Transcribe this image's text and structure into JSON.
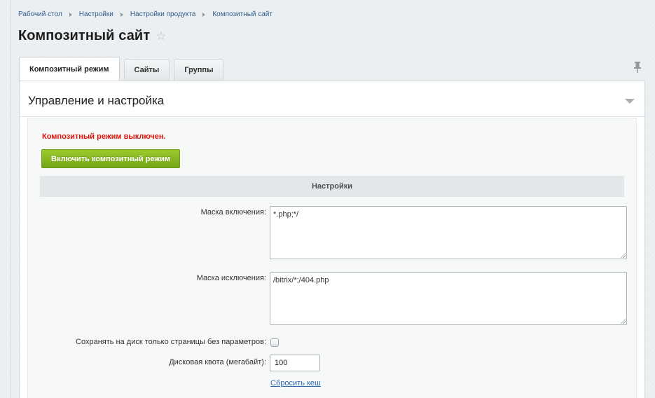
{
  "breadcrumb": {
    "items": [
      "Рабочий стол",
      "Настройки",
      "Настройки продукта",
      "Композитный сайт"
    ]
  },
  "page": {
    "title": "Композитный сайт",
    "favorite_icon": "star-icon"
  },
  "tabs": [
    {
      "label": "Композитный режим",
      "active": true
    },
    {
      "label": "Сайты",
      "active": false
    },
    {
      "label": "Группы",
      "active": false
    }
  ],
  "pin_icon": "pin-icon",
  "section": {
    "title": "Управление и настройка",
    "collapse_icon": "chevron-down-icon"
  },
  "status": {
    "text": "Композитный режим выключен.",
    "color": "#e0140a"
  },
  "enable_button": {
    "label": "Включить композитный режим",
    "color": "#84b51f"
  },
  "settings": {
    "heading": "Настройки",
    "include_mask": {
      "label": "Маска включения:",
      "value": "*.php;*/"
    },
    "exclude_mask": {
      "label": "Маска исключения:",
      "value": "/bitrix/*;/404.php"
    },
    "save_without_params": {
      "label": "Сохранять на диск только страницы без параметров:",
      "checked": false
    },
    "disk_quota": {
      "label": "Дисковая квота (мегабайт):",
      "value": "100"
    },
    "reset_cache_link": "Сбросить кеш"
  }
}
